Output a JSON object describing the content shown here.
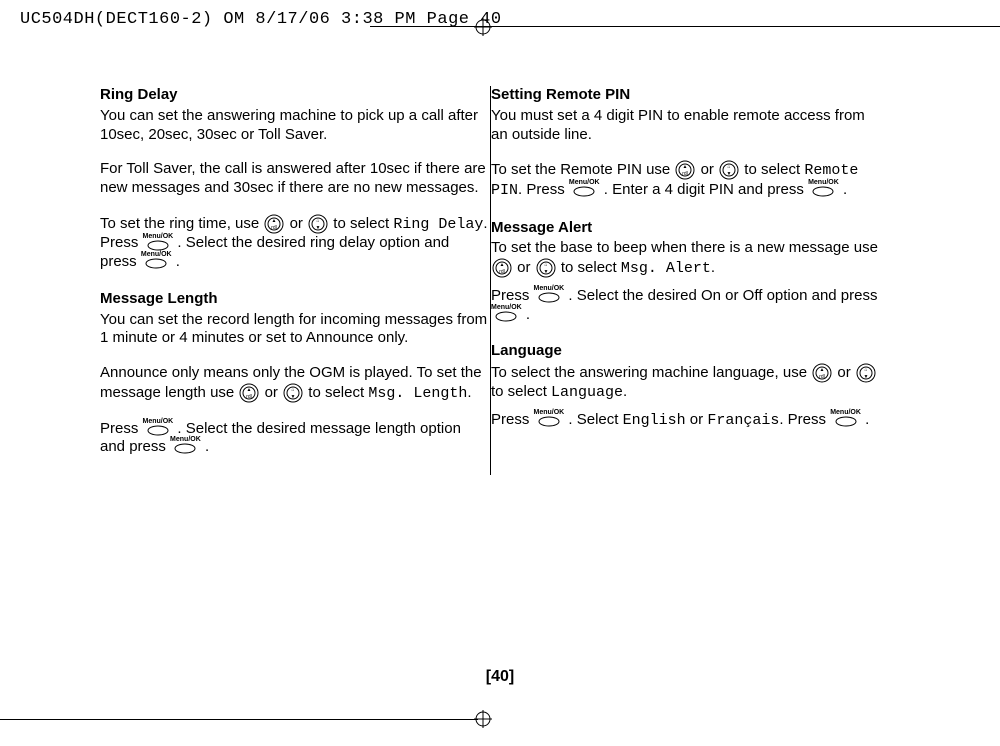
{
  "header": "UC504DH(DECT160-2) OM  8/17/06  3:38 PM  Page 40",
  "page_number": "[40]",
  "icons": {
    "up": "up-rdl-icon",
    "down": "down-icon",
    "menuok": "Menu/OK"
  },
  "left": {
    "ring_delay": {
      "title": "Ring Delay",
      "p1": "You can set the answering machine to pick up a call after 10sec, 20sec, 30sec or Toll Saver.",
      "p2": "For Toll Saver, the call is answered after 10sec if there are new messages and 30sec if there are no new messages.",
      "l1a": "To set the ring time, use ",
      "l1b": " or ",
      "l1c": " to select ",
      "option": "Ring Delay",
      "l2a": ". Press ",
      "l2b": " . Select the desired ring delay option and press ",
      "l2c": " ."
    },
    "msg_length": {
      "title": "Message Length",
      "p1": "You can set the record length for incoming messages from 1 minute or 4 minutes or set to Announce only.",
      "l1a": "Announce only means only the OGM is played. To set the message length use ",
      "l1b": " or ",
      "l1c": " to select ",
      "option": "Msg. Length",
      "l2a": "Press ",
      "l2b": " . Select the desired message length option and press ",
      "l2c": " ."
    }
  },
  "right": {
    "remote_pin": {
      "title": "Setting Remote PIN",
      "p1": "You must set a 4 digit PIN to enable remote access from an outside line.",
      "l1a": "To set the Remote PIN use ",
      "l1b": " or ",
      "l1c": " to select ",
      "option": "Remote PIN",
      "l2a": ". Press ",
      "l2b": " . Enter a 4 digit PIN and press ",
      "l2c": " ."
    },
    "msg_alert": {
      "title": "Message Alert",
      "l1a": "To set the base to beep when there is a new message use ",
      "l1b": " or ",
      "l1c": " to select ",
      "option": "Msg. Alert",
      "l2a": "Press ",
      "l2b": " . Select the desired On or Off option and press ",
      "l2c": " ."
    },
    "language": {
      "title": "Language",
      "l1a": "To select the answering machine language, use ",
      "l1b": " or ",
      "l1c": " to select ",
      "option": "Language",
      "l2a": "Press ",
      "l2b": " . Select ",
      "opt_en": "English",
      "l2c": " or ",
      "opt_fr": "Français",
      "l2d": ". Press  ",
      "l2e": " ."
    }
  }
}
